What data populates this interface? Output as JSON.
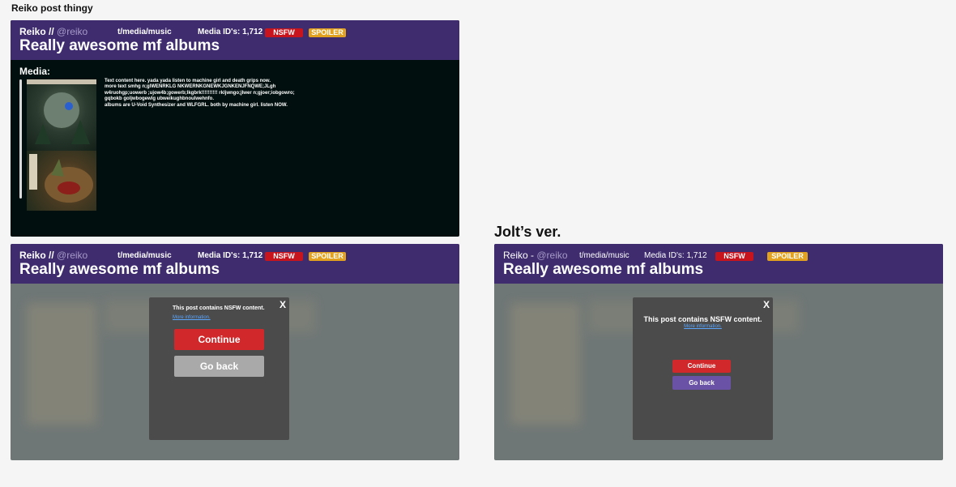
{
  "frames": {
    "frame1_title": "Reiko post thingy",
    "frame2_title": "Jolt’s ver."
  },
  "post": {
    "user": "Reiko //",
    "user_alt": "Reiko -",
    "handle": "@reiko",
    "subforum": "t/media/music",
    "media_ids": "Media ID's: 1,712",
    "tag_nsfw": "NSFW",
    "tag_spoiler": "SPOILER",
    "title": "Really awesome mf albums",
    "media_label": "Media:",
    "body": "Text content here. yada yada listen to machine girl and death grips now.\nmore text smhg n;glWENRKLG NKWERNKGNEWKJGNKENJFNQWE;JLgh\nw4ruohgp;uowerb ;ujow4b;gowerb;lkgbrk!!!!!!!!!! rkljwngo;jlwer n;gjoer;iobgowro;\ngqbokb goljwbogewlg ubweikughbnoulwehnfo.\nalbums are U-Void Synthesizer and WLFGRL. both by machine girl. listen NOW."
  },
  "dialog_a": {
    "close": "X",
    "message": "This post contains NSFW content.",
    "more": "More information.",
    "continue": "Continue",
    "go_back": "Go back"
  },
  "dialog_b": {
    "close": "X",
    "message": "This post contains NSFW content.",
    "more": "More information.",
    "continue": "Continue",
    "go_back": "Go back"
  },
  "colors": {
    "header": "#3e2c6f",
    "nsfw": "#c8141d",
    "spoiler": "#e2a21f",
    "continue": "#d1292b",
    "go_back_a": "#a9a9a9",
    "go_back_b": "#6a53a7"
  }
}
